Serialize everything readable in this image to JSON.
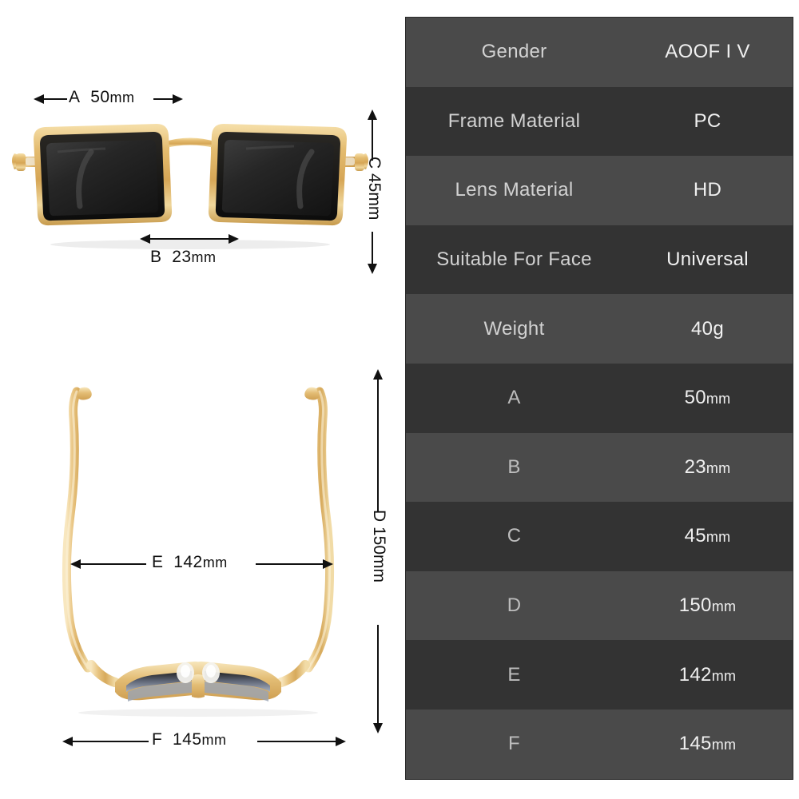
{
  "product": {
    "type": "sunglasses",
    "frame_color": "gold",
    "lens_color": "black"
  },
  "diagram": {
    "front_view": {
      "measurements": [
        {
          "code": "A",
          "value": "50",
          "unit": "mm",
          "label": "A  50mm",
          "orientation": "horizontal",
          "position": "top"
        },
        {
          "code": "B",
          "value": "23",
          "unit": "mm",
          "label": "B  23mm",
          "orientation": "horizontal",
          "position": "bottom"
        },
        {
          "code": "C",
          "value": "45",
          "unit": "mm",
          "label": "C  45mm",
          "orientation": "vertical",
          "position": "right"
        }
      ]
    },
    "top_view": {
      "measurements": [
        {
          "code": "E",
          "value": "142",
          "unit": "mm",
          "label": "E  142mm",
          "orientation": "horizontal",
          "position": "middle"
        },
        {
          "code": "F",
          "value": "145",
          "unit": "mm",
          "label": "F  145mm",
          "orientation": "horizontal",
          "position": "bottom"
        },
        {
          "code": "D",
          "value": "150",
          "unit": "mm",
          "label": "D  150mm",
          "orientation": "vertical",
          "position": "right"
        }
      ]
    },
    "labels": {
      "a_code": "A",
      "a_num": "50",
      "a_unit": "mm",
      "b_code": "B",
      "b_num": "23",
      "b_unit": "mm",
      "c_text": "C  45mm",
      "d_text": "D  150mm",
      "e_code": "E",
      "e_num": "142",
      "e_unit": "mm",
      "f_code": "F",
      "f_num": "145",
      "f_unit": "mm"
    }
  },
  "spec_table": {
    "rows": [
      {
        "key": "Gender",
        "value": "AOOF I V",
        "unit": "",
        "shade": "odd"
      },
      {
        "key": "Frame Material",
        "value": "PC",
        "unit": "",
        "shade": "even"
      },
      {
        "key": "Lens Material",
        "value": "HD",
        "unit": "",
        "shade": "odd"
      },
      {
        "key": "Suitable For Face",
        "value": "Universal",
        "unit": "",
        "shade": "even"
      },
      {
        "key": "Weight",
        "value": "40g",
        "unit": "",
        "shade": "odd"
      },
      {
        "key": "A",
        "value": "50",
        "unit": "mm",
        "shade": "even"
      },
      {
        "key": "B",
        "value": "23",
        "unit": "mm",
        "shade": "odd"
      },
      {
        "key": "C",
        "value": "45",
        "unit": "mm",
        "shade": "even"
      },
      {
        "key": "D",
        "value": "150",
        "unit": "mm",
        "shade": "odd"
      },
      {
        "key": "E",
        "value": "142",
        "unit": "mm",
        "shade": "even"
      },
      {
        "key": "F",
        "value": "145",
        "unit": "mm",
        "shade": "odd"
      }
    ]
  },
  "colors": {
    "row_light": "#4a4a4a",
    "row_dark": "#333333",
    "key_text": "#d2d2d2",
    "value_text": "#f0f0f0",
    "background": "#ffffff",
    "gold": "#e8bf78",
    "lens": "#262626"
  }
}
